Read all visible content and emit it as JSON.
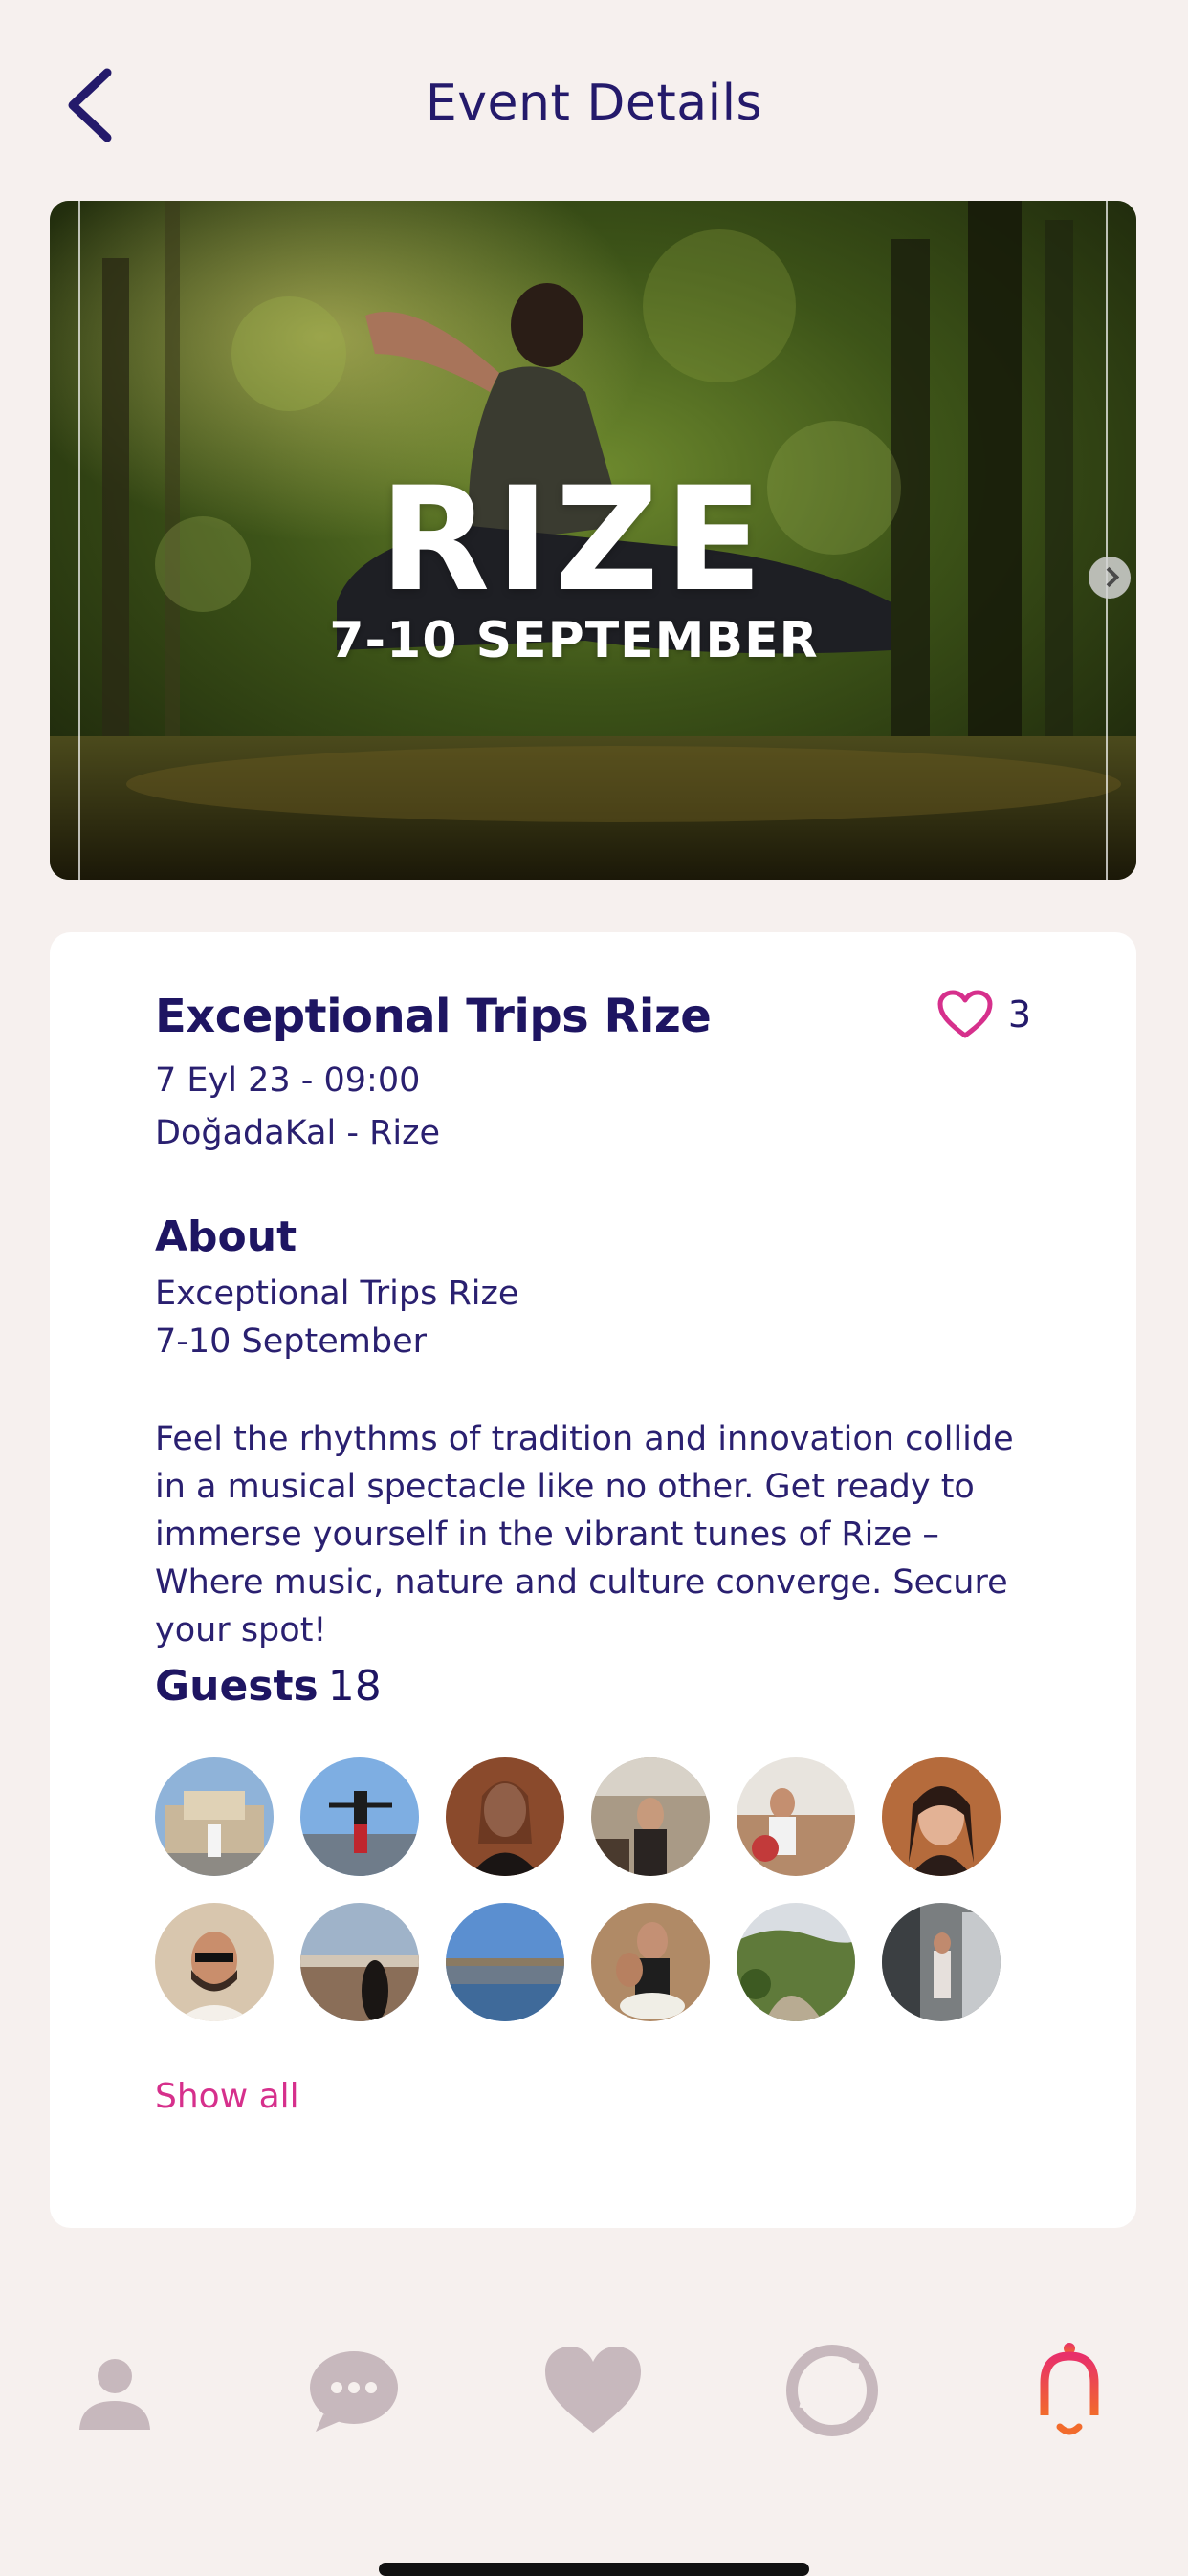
{
  "header": {
    "title": "Event Details",
    "back_icon": "chevron-left-icon"
  },
  "hero": {
    "title": "RIZE",
    "subtitle": "7-10 SEPTEMBER",
    "next_icon": "chevron-right-icon"
  },
  "event": {
    "title": "Exceptional Trips Rize",
    "date": "7 Eyl 23 - 09:00",
    "location": "DoğadaKal - Rize",
    "likes": "3",
    "like_icon": "heart-outline-icon",
    "accent_color": "#d6308c"
  },
  "about": {
    "heading": "About",
    "line1": "Exceptional Trips Rize",
    "line2": "7-10 September",
    "description": "Feel the rhythms of tradition and innovation collide in a musical spectacle like no other. Get ready to immerse yourself in the vibrant tunes of Rize – Where music, nature and culture converge. Secure your spot!"
  },
  "guests": {
    "heading": "Guests",
    "count": "18",
    "show_all": "Show all"
  },
  "bottom_nav": {
    "items": [
      "profile-icon",
      "chat-bubble-icon",
      "heart-icon",
      "ring-icon",
      "bell-icon"
    ],
    "active_color": "#f04a3a",
    "inactive_color": "#c7b8bd"
  }
}
